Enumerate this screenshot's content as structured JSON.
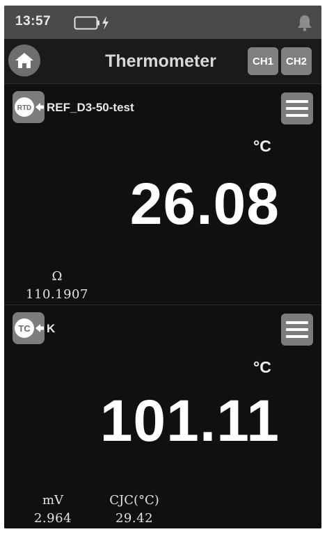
{
  "status_bar": {
    "time": "13:57"
  },
  "header": {
    "title": "Thermometer",
    "channel_buttons": [
      "CH1",
      "CH2"
    ]
  },
  "channels": [
    {
      "sensor_type": "RTD",
      "sensor_name": "REF_D3-50-test",
      "unit": "°C",
      "reading": "26.08",
      "aux": [
        {
          "label": "Ω",
          "value": "110.1907"
        }
      ]
    },
    {
      "sensor_type": "TC",
      "sensor_name": "K",
      "unit": "°C",
      "reading": "101.11",
      "aux": [
        {
          "label": "mV",
          "value": "2.964"
        },
        {
          "label": "CJC(°C)",
          "value": "29.42"
        }
      ]
    }
  ],
  "icons": {
    "home": "home-icon",
    "battery": "battery-charging-icon",
    "bell": "bell-icon",
    "menu": "hamburger-menu-icon",
    "sensor_arrow": "arrow-left-icon"
  },
  "colors": {
    "background": "#111111",
    "status_bar": "#4a4a4a",
    "button_gray": "#7c7c7c",
    "text": "#ffffff"
  }
}
